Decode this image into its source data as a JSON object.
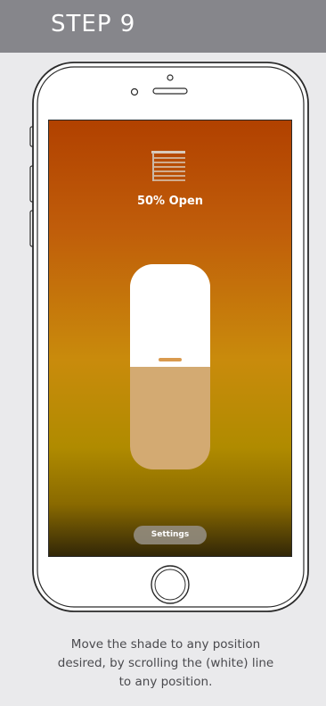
{
  "header": {
    "step_label": "STEP 9"
  },
  "screen": {
    "status_text": "50% Open",
    "open_fraction": 0.5,
    "settings_label": "Settings"
  },
  "caption": {
    "text": "Move the shade to any position desired, by scrolling the (white) line to any position."
  },
  "icons": {
    "shade": "window-shade-icon",
    "camera": "front-camera-icon",
    "speaker": "earpiece-speaker-icon",
    "home": "home-button-icon"
  },
  "colors": {
    "header_bg": "#86868b",
    "card_bg": "#eaeaec",
    "slider_fill": "#d3aa72",
    "slider_empty": "#ffffff",
    "handle": "#d99a4e"
  }
}
